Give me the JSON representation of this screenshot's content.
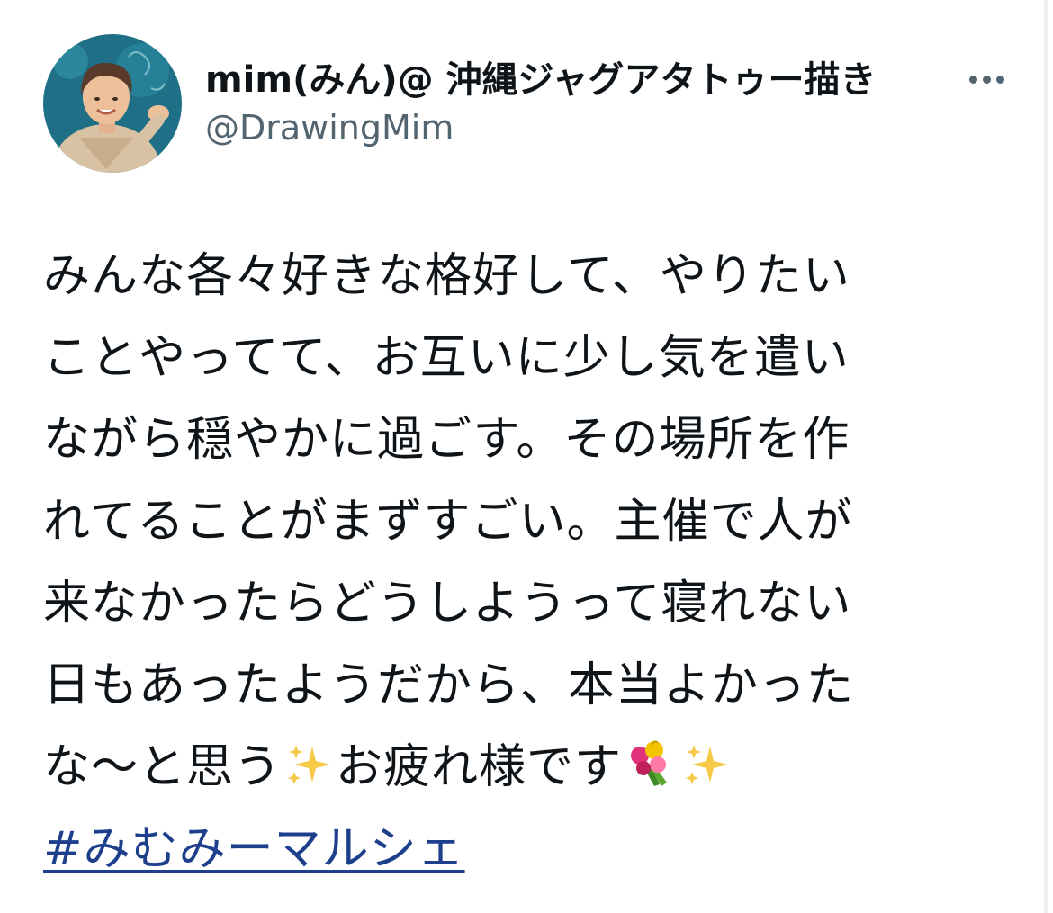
{
  "author": {
    "display_name": "mim(みん)@ 沖縄ジャグアタトゥー描き",
    "handle": "@DrawingMim"
  },
  "more_icon": "more-horizontal-icon",
  "tweet": {
    "lines": [
      "みんな各々好きな格好して、やりたい",
      "ことやってて、お互いに少し気を遣い",
      "ながら穏やかに過ごす。その場所を作",
      "れてることがまずすごい。主催で人が",
      "来なかったらどうしようって寝れない",
      "日もあったようだから、本当よかった"
    ],
    "last_line_part1": "な〜と思う",
    "last_line_part2": "お疲れ様です",
    "emojis": [
      "sparkles-icon",
      "bouquet-icon",
      "sparkles-icon"
    ],
    "hashtag": "#みむみーマルシェ"
  },
  "colors": {
    "text": "#0f1419",
    "secondary": "#536471",
    "hashtag": "#1d3f8c"
  }
}
